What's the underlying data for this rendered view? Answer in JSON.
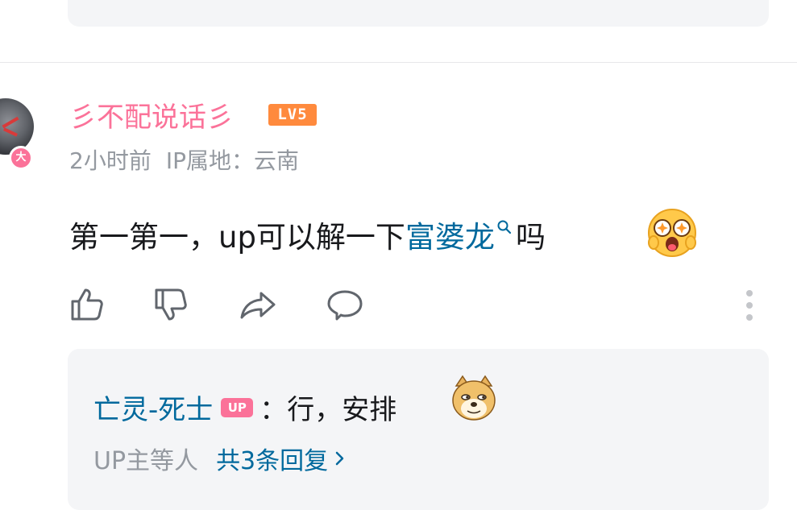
{
  "comment": {
    "username": "彡不配说话彡",
    "level": "LV5",
    "avatar_badge": "大",
    "time": "2小时前",
    "ip_location": "IP属地：云南",
    "text_prefix": "第一第一，up可以解一下",
    "link_text": "富婆龙",
    "text_suffix": "吗",
    "emoji": "shocked-face-emoji",
    "actions": {
      "like_icon": "thumbs-up-icon",
      "dislike_icon": "thumbs-down-icon",
      "share_icon": "share-icon",
      "reply_icon": "comment-icon",
      "more_icon": "more-vertical-icon"
    }
  },
  "reply_preview": {
    "author": "亡灵-死士",
    "author_badge": "UP",
    "text": "：行，安排",
    "emoji": "doge-emoji",
    "summary": "UP主等人",
    "view_replies": "共3条回复"
  },
  "colors": {
    "username": "#fb7299",
    "level_badge": "#ff8a3d",
    "link": "#00699d",
    "meta": "#9499a0",
    "card_bg": "#f4f5f7"
  }
}
